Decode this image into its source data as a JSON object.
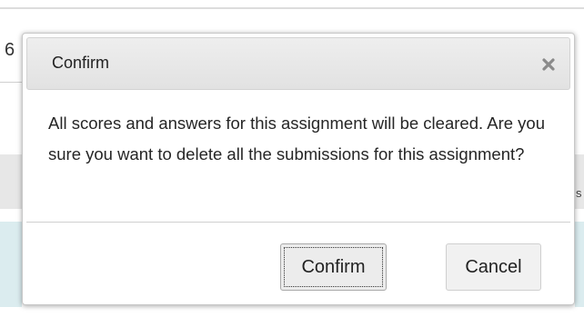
{
  "background": {
    "left_fragment": "6",
    "right_fragment": "s"
  },
  "dialog": {
    "title": "Confirm",
    "close_icon": "close-icon",
    "message": "All scores and answers for this assignment will be cleared. Are you sure you want to delete all the submissions for this assignment?",
    "buttons": {
      "confirm_label": "Confirm",
      "cancel_label": "Cancel"
    }
  },
  "colors": {
    "titlebar": "#e6e6e6",
    "button_bg": "#f1f1f1",
    "background_row_blue": "#dbecef",
    "background_row_gray": "#e7e7e7"
  }
}
